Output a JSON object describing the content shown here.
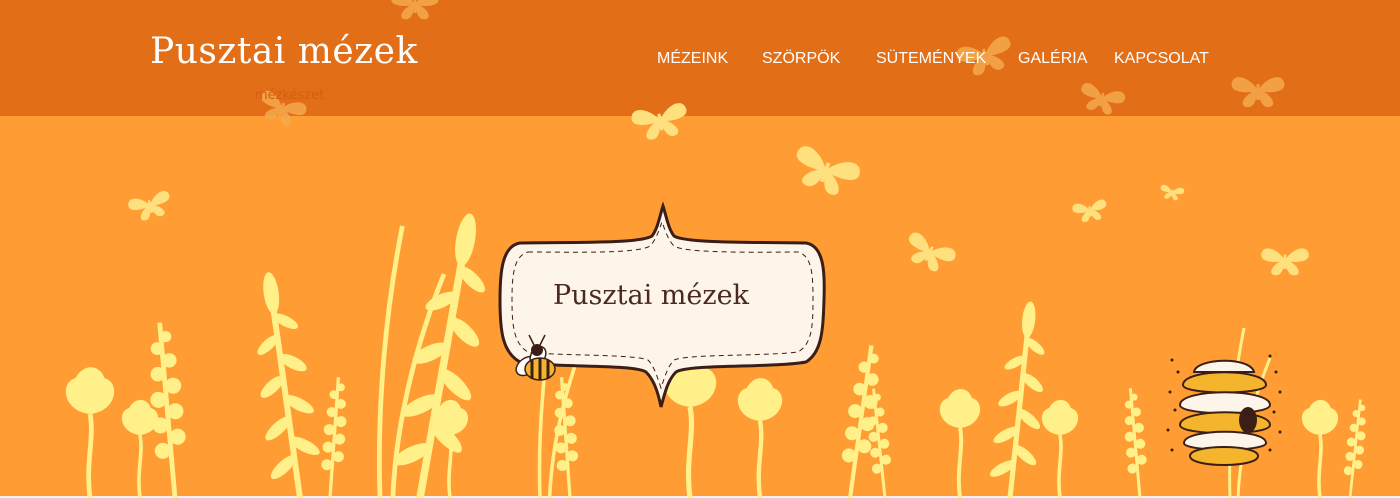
{
  "site": {
    "brand": "Pusztai mézek",
    "tagline": "mézkészet"
  },
  "nav": {
    "items": [
      {
        "label": "MÉZEINK"
      },
      {
        "label": "SZÖRPÖK"
      },
      {
        "label": "SÜTEMÉNYEK"
      },
      {
        "label": "GALÉRIA"
      },
      {
        "label": "KAPCSOLAT"
      }
    ]
  },
  "hero": {
    "badge_title": "Pusztai mézek"
  },
  "colors": {
    "header": "#e26e17",
    "hero": "#ff9c33",
    "plants": "#fff08a",
    "badge": "#fdf4ea",
    "badge_text": "#4a2a1e"
  },
  "icons": [
    "butterfly-icon",
    "bee-icon",
    "beehive-icon"
  ]
}
